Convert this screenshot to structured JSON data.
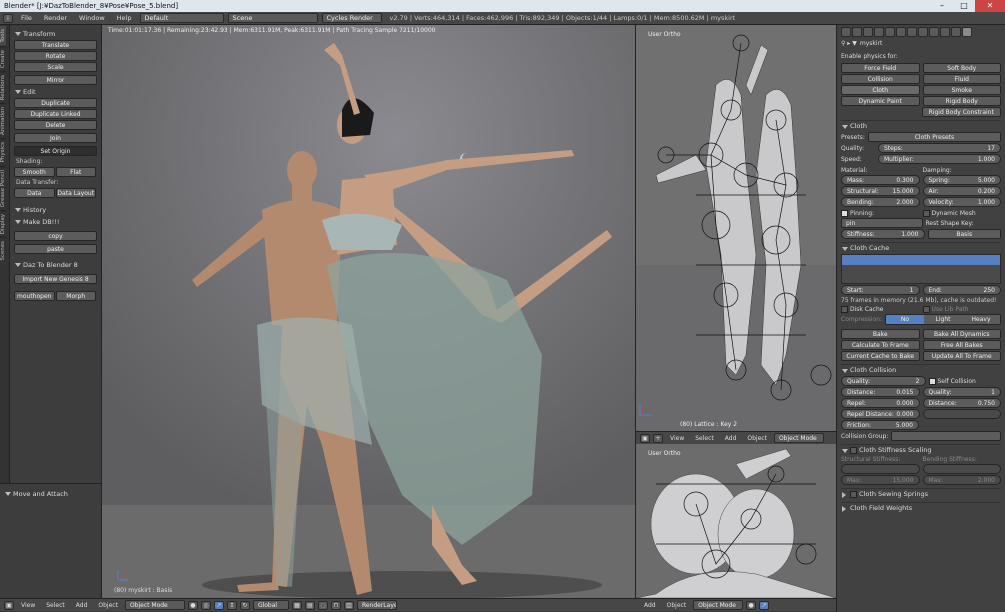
{
  "window": {
    "title": "Blender* [J:¥DazToBlender_8¥Pose¥Pose_5.blend]"
  },
  "menubar": {
    "items": [
      "File",
      "Render",
      "Window",
      "Help"
    ],
    "screen": "Default",
    "scene": "Scene",
    "engine": "Cycles Render",
    "stats": "v2.79 | Verts:464,314 | Faces:462,996 | Tris:892,349 | Objects:1/44 | Lamps:0/1 | Mem:8500.62M | myskirt"
  },
  "left_tabs": [
    "Tools",
    "Create",
    "Relations",
    "Animation",
    "Physics",
    "Grease Pencil",
    "Display",
    "Scenes"
  ],
  "toolshelf": {
    "transform": {
      "title": "Transform",
      "buttons": [
        "Translate",
        "Rotate",
        "Scale",
        "Mirror"
      ]
    },
    "edit": {
      "title": "Edit",
      "buttons": [
        "Duplicate",
        "Duplicate Linked",
        "Delete",
        "Join",
        "Set Origin"
      ],
      "shading_label": "Shading:",
      "smooth": "Smooth",
      "flat": "Flat",
      "data_transfer_label": "Data Transfer:",
      "data": "Data",
      "data_layout": "Data Layout"
    },
    "history": {
      "title": "History"
    },
    "makedb": {
      "title": "Make DB!!!",
      "buttons": [
        "copy",
        "paste"
      ]
    },
    "daz": {
      "title": "Daz To Blender 8",
      "import": "Import New Genesis 8",
      "mouthopen": "mouthopen",
      "morph": "Morph"
    },
    "move_attach": "Move and Attach"
  },
  "viewport": {
    "info": "Time:01:01:17.36 | Remaining:23:42.93 | Mem:6311.91M, Peak:6311.91M | Path Tracing Sample 7211/10000",
    "object_label": "(80) myskirt : Basis"
  },
  "bottom_bar": {
    "view": "View",
    "select": "Select",
    "add": "Add",
    "object": "Object",
    "mode": "Object Mode",
    "orientation": "Global",
    "render_layer": "RenderLayer"
  },
  "ortho_top": {
    "label": "User Ortho",
    "footer": "(80) Lattice : Key 2"
  },
  "ortho_mid_bar": {
    "view": "View",
    "select": "Select",
    "add": "Add",
    "object": "Object",
    "mode": "Object Mode"
  },
  "ortho_bottom": {
    "label": "User Ortho"
  },
  "ortho_bottom_bar": {
    "add": "Add",
    "object": "Object",
    "mode": "Object Mode"
  },
  "props": {
    "object_name": "myskirt",
    "enable_physics": "Enable physics for:",
    "physics": {
      "force_field": "Force Field",
      "soft_body": "Soft Body",
      "collision": "Collision",
      "fluid": "Fluid",
      "cloth": "Cloth",
      "smoke": "Smoke",
      "dynamic_paint": "Dynamic Paint",
      "rigid_body": "Rigid Body",
      "rigid_body_constraint": "Rigid Body Constraint"
    },
    "cloth": {
      "title": "Cloth",
      "presets_label": "Presets:",
      "presets": "Cloth Presets",
      "quality_label": "Quality:",
      "steps_label": "Steps:",
      "steps": "17",
      "speed_label": "Speed:",
      "multiplier_label": "Multiplier:",
      "multiplier": "1.000",
      "material_label": "Material:",
      "damping_label": "Damping:",
      "mass_label": "Mass:",
      "mass": "0.300",
      "spring_label": "Spring:",
      "spring": "5.000",
      "structural_label": "Structural:",
      "structural": "15.000",
      "air_label": "Air:",
      "air": "0.200",
      "bending_label": "Bending:",
      "bending": "2.000",
      "velocity_label": "Velocity:",
      "velocity": "1.000",
      "pinning": "Pinning:",
      "dynamic_mesh": "Dynamic Mesh",
      "pin_group": "pin",
      "rest_shape_label": "Rest Shape Key:",
      "stiffness_label": "Stiffness:",
      "stiffness": "1.000",
      "rest_shape": "Basis"
    },
    "cache": {
      "title": "Cloth Cache",
      "start_label": "Start:",
      "start": "1",
      "end_label": "End:",
      "end": "250",
      "note": "75 frames in memory (21.6 Mb), cache is outdated!",
      "disk_cache": "Disk Cache",
      "use_lib_path": "Use Lib Path",
      "compression_label": "Compression:",
      "no": "No",
      "light": "Light",
      "heavy": "Heavy",
      "bake": "Bake",
      "bake_all": "Bake All Dynamics",
      "calc_frame": "Calculate To Frame",
      "free_all": "Free All Bakes",
      "current_cache": "Current Cache to Bake",
      "update_all": "Update All To Frame"
    },
    "collision": {
      "title": "Cloth Collision",
      "quality_label": "Quality:",
      "quality": "2",
      "self_collision": "Self Collision",
      "distance_label": "Distance:",
      "distance": "0.015",
      "self_quality_label": "Quality:",
      "self_quality": "1",
      "repel_label": "Repel:",
      "repel": "0.000",
      "self_distance_label": "Distance:",
      "self_distance": "0.750",
      "repel_distance_label": "Repel Distance:",
      "repel_distance": "0.000",
      "friction_label": "Friction:",
      "friction": "5.000",
      "group_label": "Collision Group:"
    },
    "stiffness_scaling": {
      "title": "Cloth Stiffness Scaling",
      "structural_label": "Structural Stiffness:",
      "bending_label": "Bending Stiffness:",
      "max_label": "Max:",
      "max1": "15.000",
      "max2": "2.000"
    },
    "sewing": "Cloth Sewing Springs",
    "field_weights": "Cloth Field Weights"
  }
}
